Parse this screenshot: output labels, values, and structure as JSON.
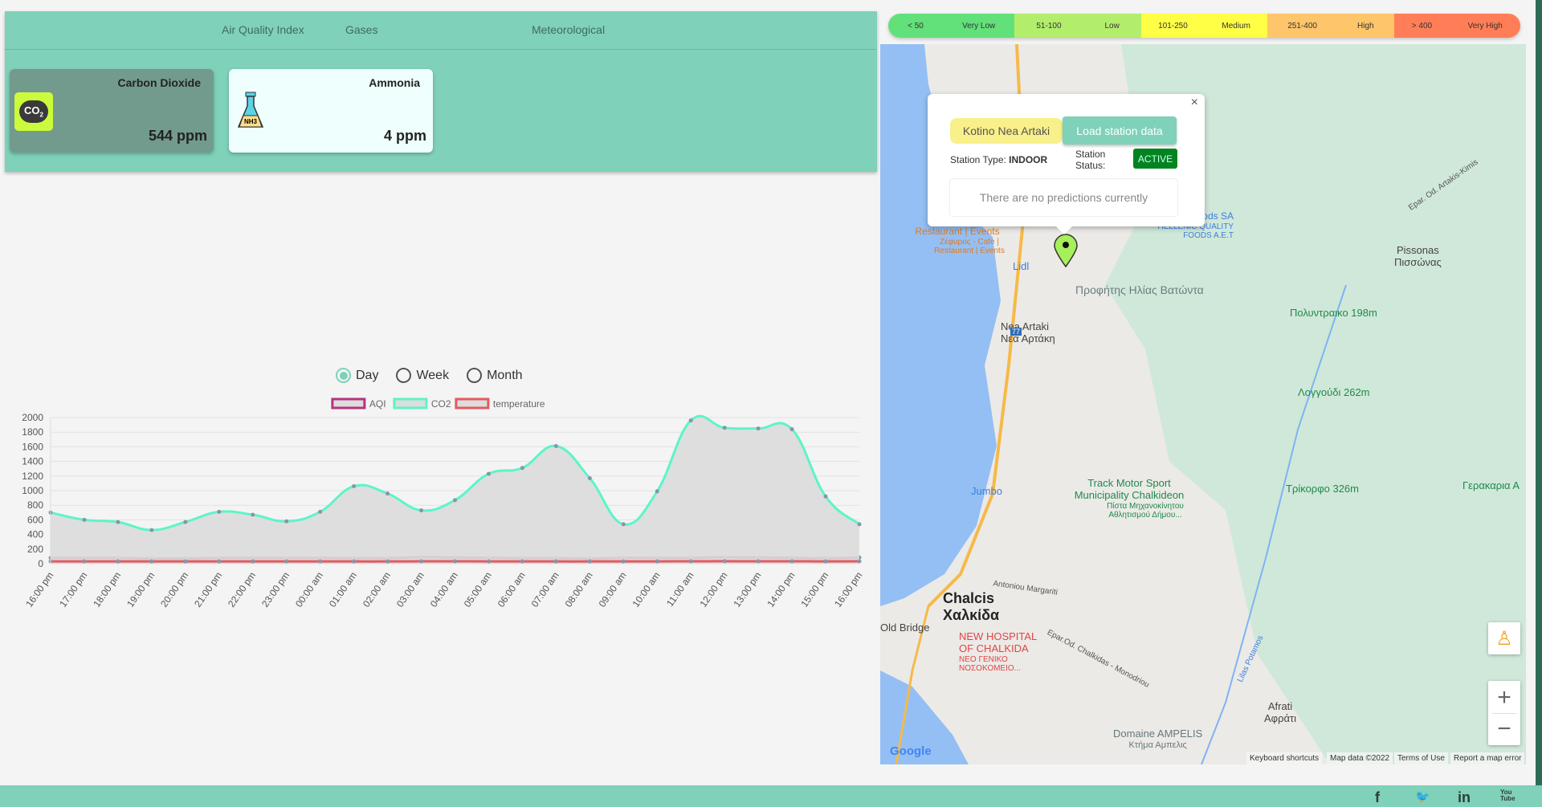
{
  "tabs": [
    "Air Quality Index",
    "Gases",
    "Meteorological"
  ],
  "cards": [
    {
      "title": "Carbon Dioxide",
      "value": "544 ppm",
      "icon": "co2-cloud-icon",
      "icon_text": "CO2"
    },
    {
      "title": "Ammonia",
      "value": "4 ppm",
      "icon": "flask-icon",
      "icon_text": "NH3"
    }
  ],
  "range": {
    "options": [
      "Day",
      "Week",
      "Month"
    ],
    "selected": "Day"
  },
  "aqi_legend": [
    {
      "range": "< 50",
      "label": "Very Low",
      "color": "#62e07a"
    },
    {
      "range": "51-100",
      "label": "Low",
      "color": "#b2ee6b"
    },
    {
      "range": "101-250",
      "label": "Medium",
      "color": "#ffff46"
    },
    {
      "range": "251-400",
      "label": "High",
      "color": "#ffc56a"
    },
    {
      "range": "> 400",
      "label": "Very High",
      "color": "#ff7e57"
    }
  ],
  "popup": {
    "station_name": "Kotino Nea Artaki",
    "load_button": "Load station data",
    "type_label": "Station Type:",
    "type_value": "INDOOR",
    "status_label": "Station Status:",
    "status_value": "ACTIVE",
    "predictions": "There are no predictions currently",
    "close": "×"
  },
  "map": {
    "labels": [
      "Nea Artaki",
      "Νέα Αρτάκη",
      "Pissonas",
      "Πισσώνας",
      "Προφήτης Ηλίας Βατώντα",
      "Πολυντραικο 198m",
      "Λογγούδι 262m",
      "Track Motor Sport",
      "Municipality Chalkideon",
      "Πίστα Μηχανοκίνητου Αθλητισμού Δήμου...",
      "Τρίκορφο 326m",
      "Γερακαρια Α",
      "Jumbo",
      "Chalcis",
      "Χαλκίδα",
      "NEW HOSPITAL",
      "OF CHALKIDA",
      "ΝΕΟ ΓΕΝΙΚΟ ΝΟΣΟΚΟΜΕΙΟ...",
      "Old Bridge",
      "Afrati",
      "Αφράτι",
      "Domaine AMPELIS",
      "Κτήμα Αμπελις",
      "Lidl",
      "Restaurant | Events",
      "Ζέφυρος - Cafe | Restaurant | Events",
      "Quality Foods SA",
      "HELLENIC QUALITY FOODS A.E.T",
      "Antoniou Margariti",
      "Epar. Od. Artakis-Kimis",
      "Epar.Od. Chalkidas - Monodriou",
      "Lilas Potamos",
      "77",
      "Google"
    ],
    "attribution": [
      "Keyboard shortcuts",
      "Map data ©2022",
      "Terms of Use",
      "Report a map error"
    ],
    "zoom_in": "+",
    "zoom_out": "−"
  },
  "footer": {
    "social": [
      "facebook-icon",
      "twitter-icon",
      "linkedin-icon",
      "youtube-icon"
    ],
    "glyphs": [
      "f",
      "🐦",
      "in",
      "You Tube"
    ]
  },
  "chart_data": {
    "type": "line",
    "x": [
      "16:00 pm",
      "17:00 pm",
      "18:00 pm",
      "19:00 pm",
      "20:00 pm",
      "21:00 pm",
      "22:00 pm",
      "23:00 pm",
      "00:00 am",
      "01:00 am",
      "02:00 am",
      "03:00 am",
      "04:00 am",
      "05:00 am",
      "06:00 am",
      "07:00 am",
      "08:00 am",
      "09:00 am",
      "10:00 am",
      "11:00 am",
      "12:00 pm",
      "13:00 pm",
      "14:00 pm",
      "15:00 pm",
      "16:00 pm"
    ],
    "series": [
      {
        "name": "AQI",
        "color": "#b5337e",
        "values": [
          80,
          80,
          78,
          72,
          72,
          78,
          80,
          80,
          80,
          75,
          76,
          90,
          85,
          80,
          76,
          76,
          70,
          80,
          80,
          80,
          88,
          85,
          80,
          75,
          85
        ]
      },
      {
        "name": "CO2",
        "color": "#5cf5c9",
        "values": [
          700,
          600,
          570,
          460,
          570,
          710,
          670,
          580,
          710,
          1060,
          960,
          730,
          870,
          1230,
          1310,
          1610,
          1170,
          540,
          990,
          1960,
          1860,
          1850,
          1840,
          920,
          540
        ]
      },
      {
        "name": "temperature",
        "color": "#e45a5f",
        "values": [
          32,
          32,
          31,
          31,
          31,
          32,
          32,
          32,
          32,
          31,
          31,
          33,
          33,
          32,
          32,
          31,
          31,
          32,
          32,
          33,
          34,
          33,
          33,
          32,
          33
        ]
      }
    ],
    "yticks": [
      0,
      200,
      400,
      600,
      800,
      1000,
      1200,
      1400,
      1600,
      1800,
      2000
    ],
    "ylim": [
      0,
      2000
    ],
    "grid": true,
    "legend": "top",
    "fill": "#dcdcdc"
  }
}
